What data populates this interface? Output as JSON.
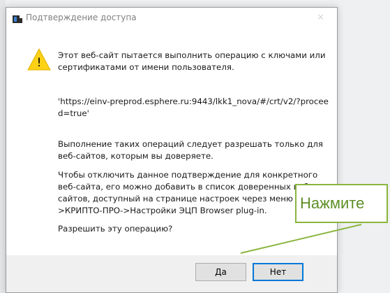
{
  "dialog": {
    "title": "Подтверждение доступа",
    "close_glyph": "✕",
    "warning_symbol": "!",
    "message": "Этот веб-сайт пытается выполнить операцию с ключами или сертификатами от имени пользователя.",
    "url": "'https://einv-preprod.esphere.ru:9443/lkk1_nova/#/crt/v2/?proceed=true'",
    "advice": "Выполнение таких операций следует разрешать только для веб-сайтов, которым вы доверяете.",
    "disable_hint": "Чтобы отключить данное подтверждение для конкретного веб-сайта, его можно добавить в список доверенных веб-сайтов, доступный на странице настроек через меню Пуск->КРИПТО-ПРО->Настройки ЭЦП Browser plug-in.",
    "question": "Разрешить эту операцию?",
    "yes_label": "Да",
    "no_label": "Нет"
  },
  "callout": {
    "label": "Нажмите",
    "color": "#8ab53d"
  },
  "icons": {
    "app": "cryptopro-app-icon",
    "warning": "warning-icon"
  }
}
